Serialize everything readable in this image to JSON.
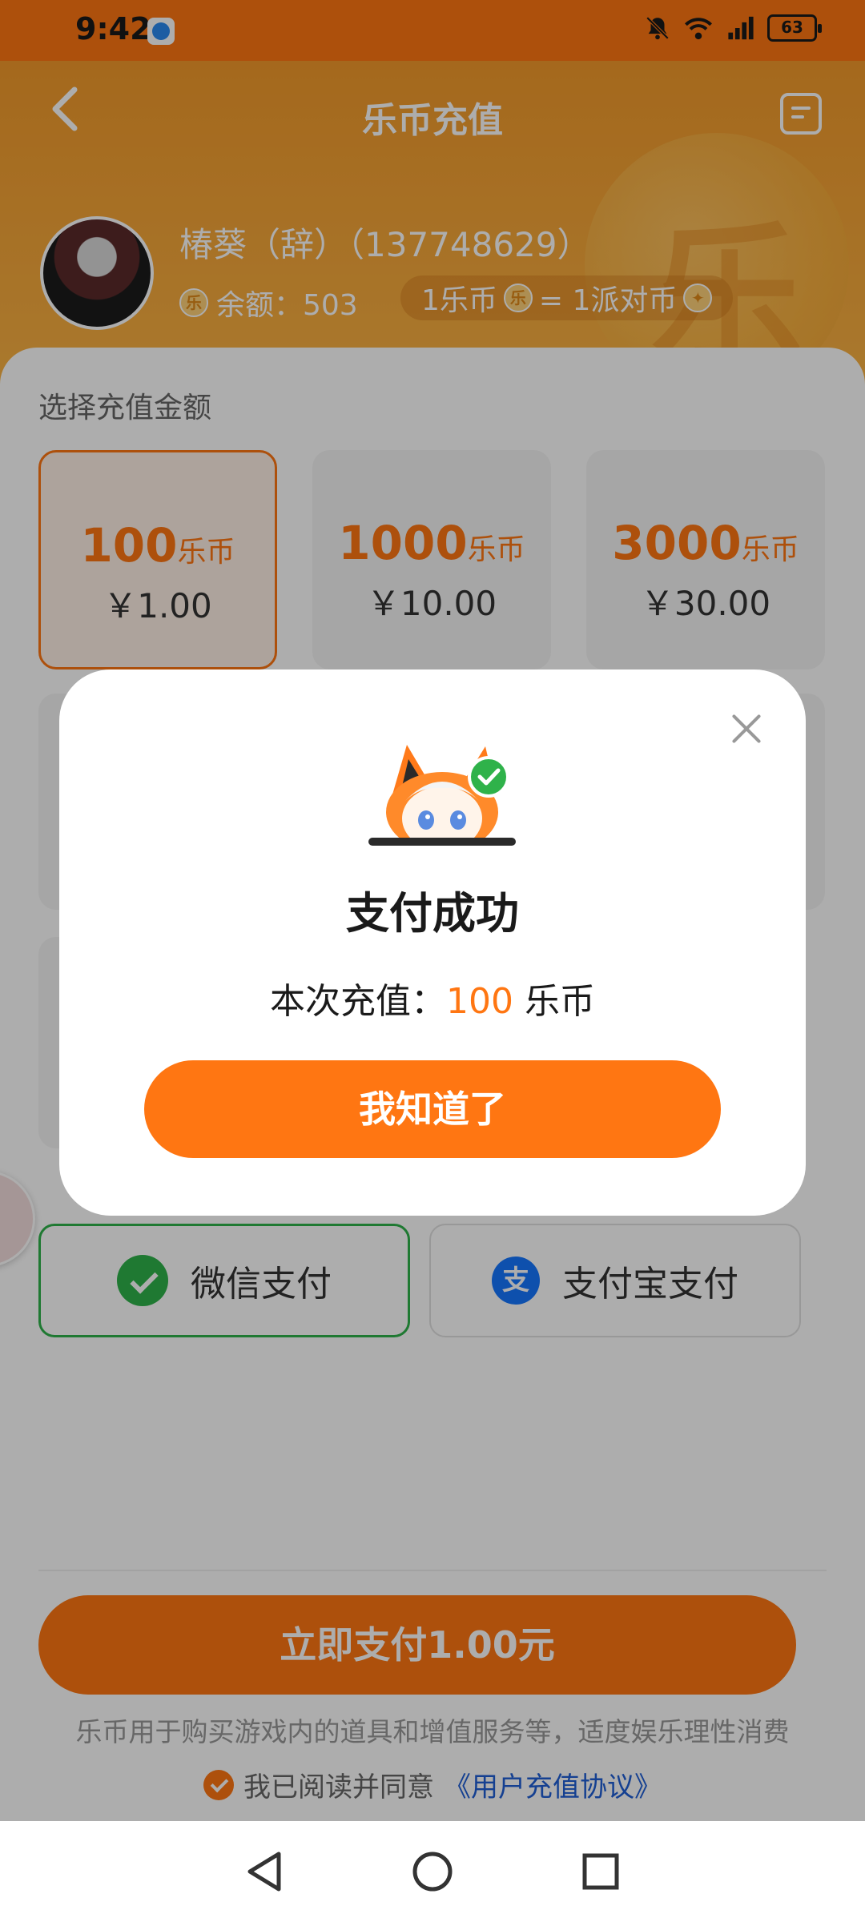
{
  "status_bar": {
    "time": "9:42",
    "battery": "63",
    "icons": [
      "app-icon",
      "bell-muted-icon",
      "wifi-icon",
      "signal-icon",
      "battery-icon"
    ]
  },
  "header": {
    "title": "乐币充值",
    "user_name": "椿葵（辞）（137748629）",
    "balance_label": "余额：503",
    "rate_left": "1乐币",
    "rate_right": "= 1派对币",
    "coin_glyph": "乐"
  },
  "recharge": {
    "section_label": "选择充值金额",
    "coin_unit": "乐币",
    "options": [
      {
        "coins": "100",
        "price": "￥1.00"
      },
      {
        "coins": "1000",
        "price": "￥10.00"
      },
      {
        "coins": "3000",
        "price": "￥30.00"
      }
    ]
  },
  "payment": {
    "wechat": "微信支付",
    "alipay": "支付宝支付",
    "alipay_glyph": "支"
  },
  "footer": {
    "pay_button": "立即支付1.00元",
    "disclaimer": "乐币用于购买游戏内的道具和增值服务等，适度娱乐理性消费",
    "agree_prefix": "我已阅读并同意",
    "agreement_link": "《用户充值协议》"
  },
  "dialog": {
    "title": "支付成功",
    "message_prefix": "本次充值：",
    "message_amount": "100",
    "message_suffix": " 乐币",
    "confirm_button": "我知道了"
  },
  "colors": {
    "accent": "#ff7612",
    "wechat_green": "#2eb34a",
    "alipay_blue": "#1677ff",
    "link_blue": "#1f5fd6"
  }
}
